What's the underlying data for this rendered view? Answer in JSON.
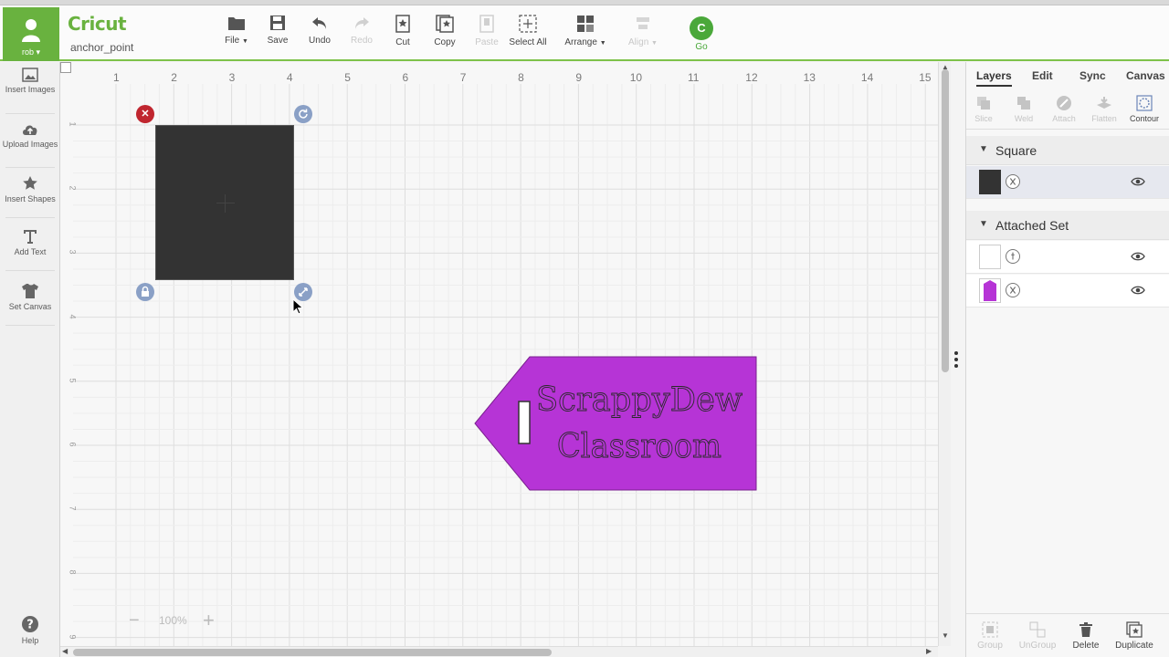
{
  "user": {
    "name": "rob ▾"
  },
  "app": {
    "logo": "Cricut",
    "project_name": "anchor_point"
  },
  "toolbar": {
    "file": "File",
    "save": "Save",
    "undo": "Undo",
    "redo": "Redo",
    "cut": "Cut",
    "copy": "Copy",
    "paste": "Paste",
    "select_all": "Select All",
    "arrange": "Arrange",
    "align": "Align",
    "go": "Go",
    "go_icon_letter": "C"
  },
  "sidebar": {
    "items": [
      {
        "label": "Insert Images"
      },
      {
        "label": "Upload Images"
      },
      {
        "label": "Insert Shapes"
      },
      {
        "label": "Add Text"
      },
      {
        "label": "Set Canvas"
      },
      {
        "label": "Help"
      }
    ]
  },
  "ruler": {
    "horizontal": [
      "1",
      "2",
      "3",
      "4",
      "5",
      "6",
      "7",
      "8",
      "9",
      "10",
      "11",
      "12",
      "13",
      "14",
      "15"
    ],
    "vertical": [
      "1",
      "2",
      "3",
      "4",
      "5",
      "6",
      "7",
      "8",
      "9"
    ]
  },
  "canvas": {
    "square_color": "#333333",
    "tag_color": "#b634d6",
    "tag_text_line1": "ScrappyDew",
    "tag_text_line2": "Classroom",
    "zoom": "100%"
  },
  "panel": {
    "tabs": [
      "Layers",
      "Edit",
      "Sync",
      "Canvas"
    ],
    "tools": [
      "Slice",
      "Weld",
      "Attach",
      "Flatten",
      "Contour"
    ],
    "groups": [
      {
        "name": "Square"
      },
      {
        "name": "Attached Set"
      }
    ],
    "bottom": [
      "Group",
      "UnGroup",
      "Delete",
      "Duplicate"
    ]
  },
  "colors": {
    "accent": "#69b23f",
    "delete_handle": "#c0262f",
    "handle": "#8aa0c6"
  }
}
